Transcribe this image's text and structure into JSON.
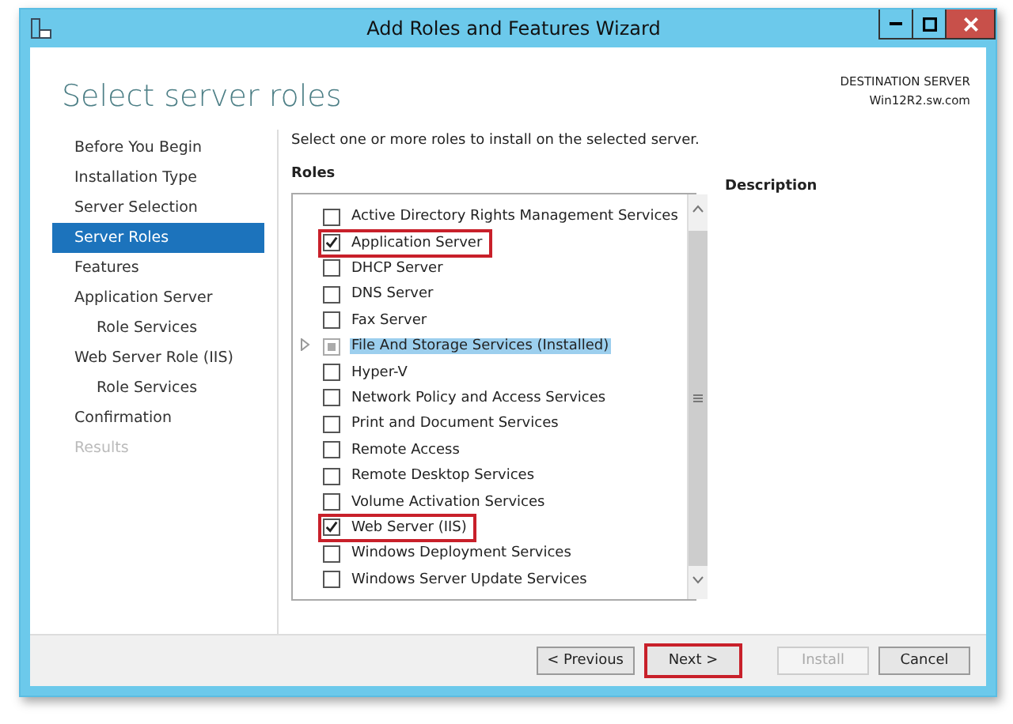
{
  "window": {
    "title": "Add Roles and Features Wizard"
  },
  "page_title": "Select server roles",
  "destination": {
    "label": "DESTINATION SERVER",
    "server": "Win12R2.sw.com"
  },
  "nav": [
    {
      "label": "Before You Begin",
      "selected": false,
      "disabled": false
    },
    {
      "label": "Installation Type",
      "selected": false,
      "disabled": false
    },
    {
      "label": "Server Selection",
      "selected": false,
      "disabled": false
    },
    {
      "label": "Server Roles",
      "selected": true,
      "disabled": false
    },
    {
      "label": "Features",
      "selected": false,
      "disabled": false
    },
    {
      "label": "Application Server",
      "selected": false,
      "disabled": false,
      "children": [
        {
          "label": "Role Services",
          "selected": false,
          "disabled": false
        }
      ]
    },
    {
      "label": "Web Server Role (IIS)",
      "selected": false,
      "disabled": false,
      "children": [
        {
          "label": "Role Services",
          "selected": false,
          "disabled": false
        }
      ]
    },
    {
      "label": "Confirmation",
      "selected": false,
      "disabled": false
    },
    {
      "label": "Results",
      "selected": false,
      "disabled": true
    }
  ],
  "instruction": "Select one or more roles to install on the selected server.",
  "roles_heading": "Roles",
  "description_heading": "Description",
  "roles": [
    {
      "label": "Active Directory Rights Management Services",
      "checked": false,
      "selected": false,
      "highlighted": false,
      "expandable": false,
      "indeterminate": false
    },
    {
      "label": "Application Server",
      "checked": true,
      "selected": false,
      "highlighted": true,
      "expandable": false,
      "indeterminate": false
    },
    {
      "label": "DHCP Server",
      "checked": false,
      "selected": false,
      "highlighted": false,
      "expandable": false,
      "indeterminate": false
    },
    {
      "label": "DNS Server",
      "checked": false,
      "selected": false,
      "highlighted": false,
      "expandable": false,
      "indeterminate": false
    },
    {
      "label": "Fax Server",
      "checked": false,
      "selected": false,
      "highlighted": false,
      "expandable": false,
      "indeterminate": false
    },
    {
      "label": "File And Storage Services (Installed)",
      "checked": false,
      "selected": true,
      "highlighted": false,
      "expandable": true,
      "indeterminate": true
    },
    {
      "label": "Hyper-V",
      "checked": false,
      "selected": false,
      "highlighted": false,
      "expandable": false,
      "indeterminate": false
    },
    {
      "label": "Network Policy and Access Services",
      "checked": false,
      "selected": false,
      "highlighted": false,
      "expandable": false,
      "indeterminate": false
    },
    {
      "label": "Print and Document Services",
      "checked": false,
      "selected": false,
      "highlighted": false,
      "expandable": false,
      "indeterminate": false
    },
    {
      "label": "Remote Access",
      "checked": false,
      "selected": false,
      "highlighted": false,
      "expandable": false,
      "indeterminate": false
    },
    {
      "label": "Remote Desktop Services",
      "checked": false,
      "selected": false,
      "highlighted": false,
      "expandable": false,
      "indeterminate": false
    },
    {
      "label": "Volume Activation Services",
      "checked": false,
      "selected": false,
      "highlighted": false,
      "expandable": false,
      "indeterminate": false
    },
    {
      "label": "Web Server (IIS)",
      "checked": true,
      "selected": false,
      "highlighted": true,
      "expandable": false,
      "indeterminate": false
    },
    {
      "label": "Windows Deployment Services",
      "checked": false,
      "selected": false,
      "highlighted": false,
      "expandable": false,
      "indeterminate": false
    },
    {
      "label": "Windows Server Update Services",
      "checked": false,
      "selected": false,
      "highlighted": false,
      "expandable": false,
      "indeterminate": false
    }
  ],
  "buttons": [
    {
      "label": "< Previous",
      "disabled": false,
      "highlighted": false
    },
    {
      "label": "Next >",
      "disabled": false,
      "highlighted": true
    },
    {
      "label": "Install",
      "disabled": true,
      "highlighted": false
    },
    {
      "label": "Cancel",
      "disabled": false,
      "highlighted": false
    }
  ]
}
